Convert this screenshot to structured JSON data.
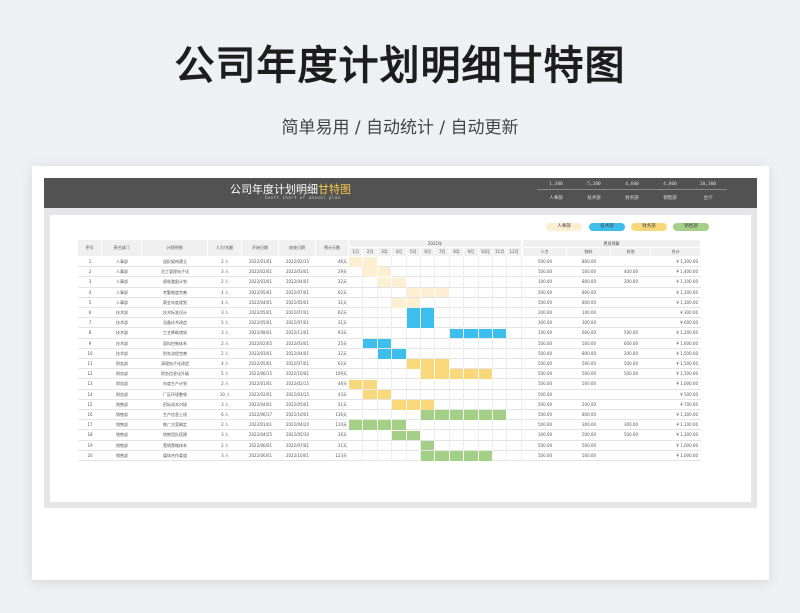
{
  "page": {
    "title": "公司年度计划明细甘特图",
    "subtitle": "简单易用  /  自动统计  /  自动更新"
  },
  "sheet": {
    "title_main": "公司年度计划明细",
    "title_highlight": "甘特图",
    "subtitle_en": "Gantt chart of annual plan",
    "summary_values": [
      "1,300",
      "5,200",
      "4,600",
      "4,800",
      "20,300"
    ],
    "summary_labels": [
      "人事部",
      "技术部",
      "财务部",
      "销售部",
      "合计"
    ]
  },
  "legend": [
    {
      "label": "人事部",
      "color": "#fcefd2"
    },
    {
      "label": "技术部",
      "color": "#3dbfee"
    },
    {
      "label": "财务部",
      "color": "#f8d87a"
    },
    {
      "label": "销售部",
      "color": "#a3cf87"
    }
  ],
  "table": {
    "headers": {
      "seq": "序号",
      "dept": "责任部门",
      "plan": "计划明细",
      "people": "人力/名额",
      "start": "开始日期",
      "end": "结束日期",
      "days": "预计天数",
      "year": "2022年",
      "budget": "费用预算",
      "labor": "人力",
      "material": "物料",
      "other": "其他",
      "total": "合计"
    },
    "months": [
      "1月",
      "2月",
      "3月",
      "4月",
      "5月",
      "6月",
      "7月",
      "8月",
      "9月",
      "10月",
      "11月",
      "12月"
    ],
    "rows": [
      {
        "seq": "1",
        "dept": "人事部",
        "plan": "组织架构建立",
        "people": "2 人",
        "start": "2022/01/01",
        "end": "2022/02/15",
        "days": "46天",
        "labor": "500.00",
        "material": "800.00",
        "other": "",
        "total": "¥ 1,300.00",
        "gs": 0,
        "ge": 2,
        "color": "#fcefd2"
      },
      {
        "seq": "2",
        "dept": "人事部",
        "plan": "员工管理电子化",
        "people": "3 人",
        "start": "2022/02/01",
        "end": "2022/03/01",
        "days": "29天",
        "labor": "500.00",
        "material": "500.00",
        "other": "400.00",
        "total": "¥ 1,400.00",
        "gs": 1,
        "ge": 3,
        "color": "#fcefd2"
      },
      {
        "seq": "3",
        "dept": "人事部",
        "plan": "绩效激励计划",
        "people": "2 人",
        "start": "2022/03/01",
        "end": "2022/04/01",
        "days": "32天",
        "labor": "100.00",
        "material": "800.00",
        "other": "200.00",
        "total": "¥ 1,100.00",
        "gs": 2,
        "ge": 4,
        "color": "#fcefd2"
      },
      {
        "seq": "4",
        "dept": "人事部",
        "plan": "考勤制度完善",
        "people": "4 人",
        "start": "2022/05/01",
        "end": "2022/07/01",
        "days": "62天",
        "labor": "500.00",
        "material": "800.00",
        "other": "",
        "total": "¥ 1,300.00",
        "gs": 4,
        "ge": 7,
        "color": "#fcefd2"
      },
      {
        "seq": "5",
        "dept": "人事部",
        "plan": "薪金年度规划",
        "people": "4 人",
        "start": "2022/04/01",
        "end": "2022/05/01",
        "days": "31天",
        "labor": "500.00",
        "material": "800.00",
        "other": "",
        "total": "¥ 1,300.00",
        "gs": 3,
        "ge": 5,
        "color": "#fcefd2"
      },
      {
        "seq": "6",
        "dept": "技术部",
        "plan": "技术标准设计",
        "people": "3 人",
        "start": "2022/05/01",
        "end": "2022/07/01",
        "days": "62天",
        "labor": "200.00",
        "material": "100.00",
        "other": "",
        "total": "¥ 300.00",
        "gs": 4,
        "ge": 6,
        "color": "#3dbfee"
      },
      {
        "seq": "7",
        "dept": "技术部",
        "plan": "设备技术改造",
        "people": "5 人",
        "start": "2022/05/01",
        "end": "2022/07/01",
        "days": "31天",
        "labor": "300.00",
        "material": "300.00",
        "other": "",
        "total": "¥ 600.00",
        "gs": 4,
        "ge": 6,
        "color": "#3dbfee"
      },
      {
        "seq": "8",
        "dept": "技术部",
        "plan": "工艺降耗增效",
        "people": "3 人",
        "start": "2022/08/01",
        "end": "2022/11/01",
        "days": "93天",
        "labor": "100.00",
        "material": "600.00",
        "other": "500.00",
        "total": "¥ 1,200.00",
        "gs": 7,
        "ge": 11,
        "color": "#3dbfee"
      },
      {
        "seq": "9",
        "dept": "技术部",
        "plan": "容料控制体系",
        "people": "2 人",
        "start": "2022/02/05",
        "end": "2022/03/01",
        "days": "25天",
        "labor": "500.00",
        "material": "500.00",
        "other": "600.00",
        "total": "¥ 1,600.00",
        "gs": 1,
        "ge": 3,
        "color": "#3dbfee"
      },
      {
        "seq": "10",
        "dept": "技术部",
        "plan": "财务流程完善",
        "people": "2 人",
        "start": "2022/03/01",
        "end": "2022/04/01",
        "days": "32天",
        "labor": "500.00",
        "material": "800.00",
        "other": "200.00",
        "total": "¥ 1,500.00",
        "gs": 2,
        "ge": 4,
        "color": "#3dbfee"
      },
      {
        "seq": "11",
        "dept": "财务部",
        "plan": "清理电子化改造",
        "people": "4 人",
        "start": "2022/05/01",
        "end": "2022/07/01",
        "days": "62天",
        "labor": "500.00",
        "material": "500.00",
        "other": "500.00",
        "total": "¥ 1,500.00",
        "gs": 4,
        "ge": 7,
        "color": "#f8d87a"
      },
      {
        "seq": "12",
        "dept": "财务部",
        "plan": "财务信息化升级",
        "people": "5 人",
        "start": "2022/06/15",
        "end": "2022/10/01",
        "days": "109天",
        "labor": "500.00",
        "material": "500.00",
        "other": "500.00",
        "total": "¥ 1,500.00",
        "gs": 5,
        "ge": 10,
        "color": "#f8d87a"
      },
      {
        "seq": "13",
        "dept": "财务部",
        "plan": "年度生产计划",
        "people": "2 人",
        "start": "2022/01/01",
        "end": "2022/02/15",
        "days": "46天",
        "labor": "500.00",
        "material": "500.00",
        "other": "",
        "total": "¥ 1,000.00",
        "gs": 0,
        "ge": 2,
        "color": "#f8d87a"
      },
      {
        "seq": "14",
        "dept": "财务部",
        "plan": "厂区环境整顿",
        "people": "10 人",
        "start": "2022/02/01",
        "end": "2022/03/15",
        "days": "43天",
        "labor": "500.00",
        "material": "",
        "other": "",
        "total": "¥ 500.00",
        "gs": 1,
        "ge": 3,
        "color": "#f8d87a"
      },
      {
        "seq": "15",
        "dept": "销售部",
        "plan": "招标成本对接",
        "people": "3 人",
        "start": "2022/04/01",
        "end": "2022/05/01",
        "days": "31天",
        "labor": "500.00",
        "material": "200.00",
        "other": "",
        "total": "¥ 700.00",
        "gs": 3,
        "ge": 6,
        "color": "#f8d87a"
      },
      {
        "seq": "16",
        "dept": "销售部",
        "plan": "生产信息上线",
        "people": "6 人",
        "start": "2022/06/17",
        "end": "2022/10/01",
        "days": "136天",
        "labor": "500.00",
        "material": "800.00",
        "other": "",
        "total": "¥ 1,300.00",
        "gs": 5,
        "ge": 11,
        "color": "#a3cf87"
      },
      {
        "seq": "17",
        "dept": "销售部",
        "plan": "推广方案确定",
        "people": "2 人",
        "start": "2022/01/01",
        "end": "2022/04/20",
        "days": "110天",
        "labor": "500.00",
        "material": "300.00",
        "other": "300.00",
        "total": "¥ 1,100.00",
        "gs": 0,
        "ge": 4,
        "color": "#a3cf87"
      },
      {
        "seq": "18",
        "dept": "销售部",
        "plan": "销售团队搭建",
        "people": "3 人",
        "start": "2022/04/25",
        "end": "2022/05/30",
        "days": "36天",
        "labor": "300.00",
        "material": "500.00",
        "other": "500.00",
        "total": "¥ 1,300.00",
        "gs": 3,
        "ge": 5,
        "color": "#a3cf87"
      },
      {
        "seq": "19",
        "dept": "销售部",
        "plan": "营销策略体系",
        "people": "2 人",
        "start": "2022/06/01",
        "end": "2022/07/01",
        "days": "31天",
        "labor": "500.00",
        "material": "500.00",
        "other": "",
        "total": "¥ 1,000.00",
        "gs": 5,
        "ge": 6,
        "color": "#a3cf87"
      },
      {
        "seq": "20",
        "dept": "销售部",
        "plan": "媒体合作渠道",
        "people": "3 人",
        "start": "2022/06/01",
        "end": "2022/10/01",
        "days": "123天",
        "labor": "500.00",
        "material": "500.00",
        "other": "",
        "total": "¥ 1,000.00",
        "gs": 5,
        "ge": 10,
        "color": "#a3cf87"
      }
    ]
  }
}
